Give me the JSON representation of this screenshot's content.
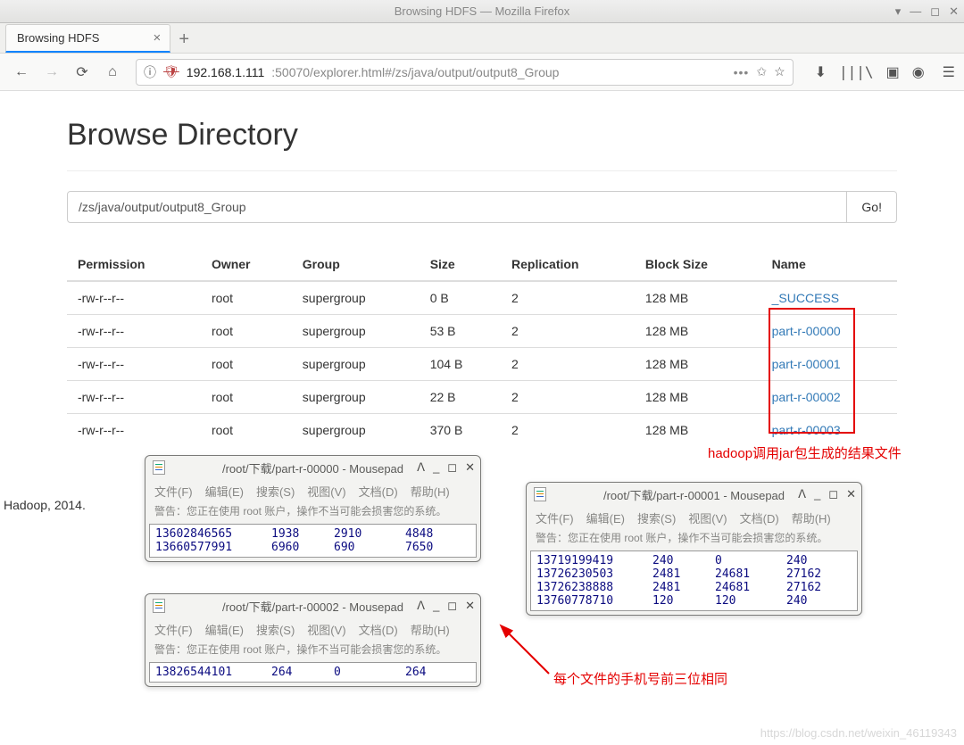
{
  "window": {
    "title": "Browsing HDFS — Mozilla Firefox",
    "tab_title": "Browsing HDFS"
  },
  "url": {
    "host": "192.168.1.111",
    "path": ":50070/explorer.html#/zs/java/output/output8_Group"
  },
  "page_title": "Browse Directory",
  "path_input": "/zs/java/output/output8_Group",
  "go_label": "Go!",
  "columns": [
    "Permission",
    "Owner",
    "Group",
    "Size",
    "Replication",
    "Block Size",
    "Name"
  ],
  "files": [
    {
      "perm": "-rw-r--r--",
      "owner": "root",
      "group": "supergroup",
      "size": "0 B",
      "rep": "2",
      "block": "128 MB",
      "name": "_SUCCESS"
    },
    {
      "perm": "-rw-r--r--",
      "owner": "root",
      "group": "supergroup",
      "size": "53 B",
      "rep": "2",
      "block": "128 MB",
      "name": "part-r-00000"
    },
    {
      "perm": "-rw-r--r--",
      "owner": "root",
      "group": "supergroup",
      "size": "104 B",
      "rep": "2",
      "block": "128 MB",
      "name": "part-r-00001"
    },
    {
      "perm": "-rw-r--r--",
      "owner": "root",
      "group": "supergroup",
      "size": "22 B",
      "rep": "2",
      "block": "128 MB",
      "name": "part-r-00002"
    },
    {
      "perm": "-rw-r--r--",
      "owner": "root",
      "group": "supergroup",
      "size": "370 B",
      "rep": "2",
      "block": "128 MB",
      "name": "part-r-00003"
    }
  ],
  "annotations": {
    "right": "hadoop调用jar包生成的结果文件",
    "bottom": "每个文件的手机号前三位相同"
  },
  "mousepad": {
    "menu": [
      "文件(F)",
      "编辑(E)",
      "搜索(S)",
      "视图(V)",
      "文档(D)",
      "帮助(H)"
    ],
    "warn": "警告：您正在使用 root 账户，操作不当可能会损害您的系统。",
    "w0": {
      "title": "/root/下载/part-r-00000 - Mousepad",
      "rows": [
        [
          "13602846565",
          "1938",
          "2910",
          "4848"
        ],
        [
          "13660577991",
          "6960",
          "690",
          "7650"
        ]
      ]
    },
    "w1": {
      "title": "/root/下载/part-r-00001 - Mousepad",
      "rows": [
        [
          "13719199419",
          "240",
          "0",
          "240"
        ],
        [
          "13726230503",
          "2481",
          "24681",
          "27162"
        ],
        [
          "13726238888",
          "2481",
          "24681",
          "27162"
        ],
        [
          "13760778710",
          "120",
          "120",
          "240"
        ]
      ]
    },
    "w2": {
      "title": "/root/下载/part-r-00002 - Mousepad",
      "rows": [
        [
          "13826544101",
          "264",
          "0",
          "264"
        ]
      ]
    }
  },
  "footer": "Hadoop, 2014.",
  "watermark": "https://blog.csdn.net/weixin_46119343"
}
